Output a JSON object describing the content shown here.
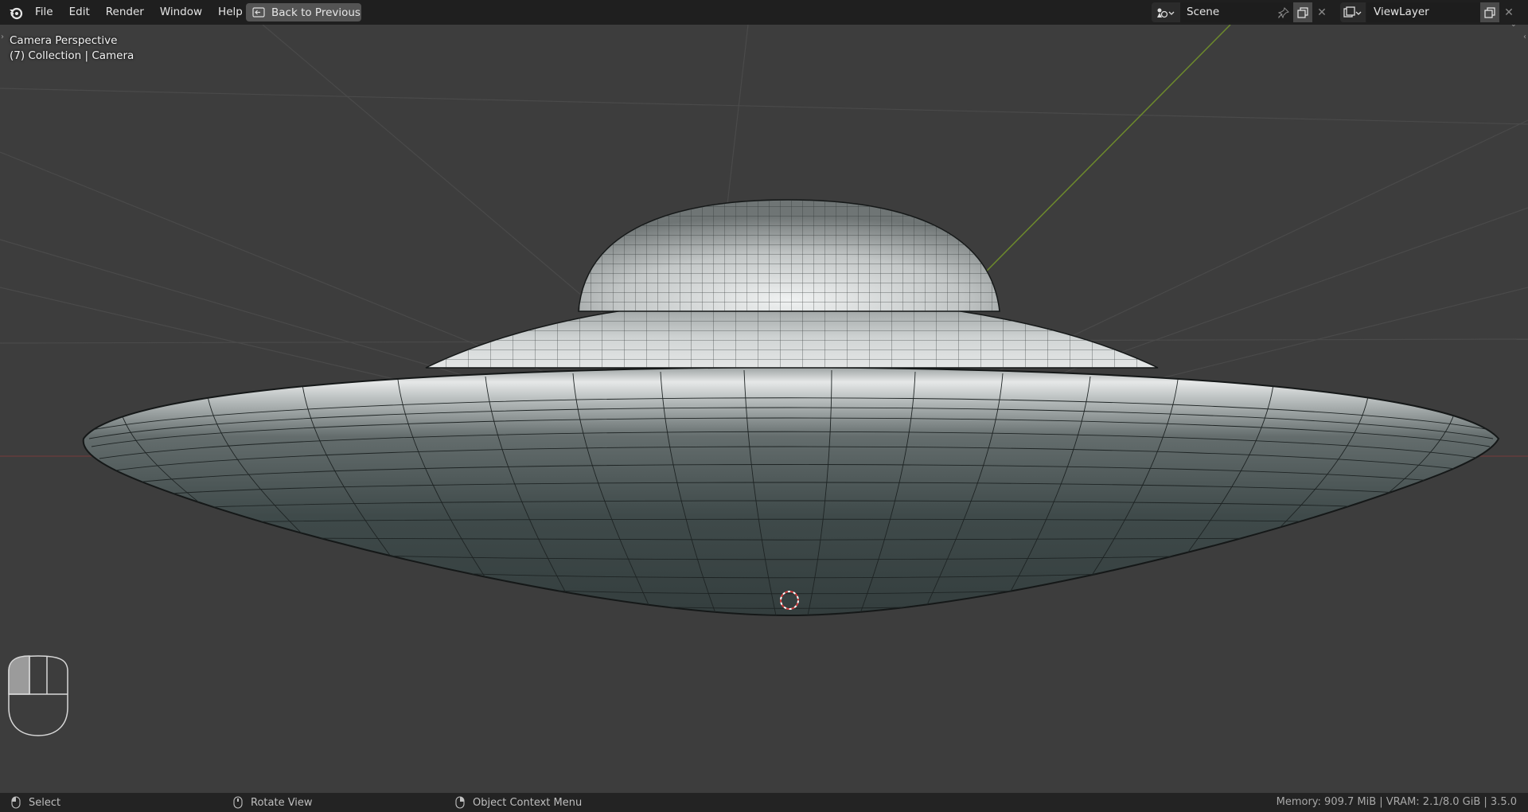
{
  "menu": {
    "items": [
      "File",
      "Edit",
      "Render",
      "Window",
      "Help"
    ]
  },
  "back_button": {
    "label": "Back to Previous"
  },
  "scene": {
    "name": "Scene"
  },
  "view_layer": {
    "name": "ViewLayer"
  },
  "viewport": {
    "view_name": "Camera Perspective",
    "collection_info": "(7) Collection | Camera"
  },
  "status": {
    "left_click": "Select",
    "middle_click": "Rotate View",
    "right_click": "Object Context Menu",
    "stats": "Memory: 909.7 MiB | VRAM: 2.1/8.0 GiB | 3.5.0"
  },
  "colors": {
    "topbar": "#1f1f1f",
    "viewport_bg": "#3d3d3d",
    "statusbar": "#232323",
    "y_axis": "#6d8a2c",
    "mesh_light": "#d9dcdc",
    "mesh_dark": "#2f3b3b"
  },
  "icons": [
    "blender-logo-icon",
    "back-to-previous-icon",
    "scene-icon",
    "pin-icon",
    "duplicate-icon",
    "close-icon",
    "view-layer-icon",
    "mouse-left-icon",
    "mouse-middle-icon",
    "mouse-right-icon"
  ]
}
